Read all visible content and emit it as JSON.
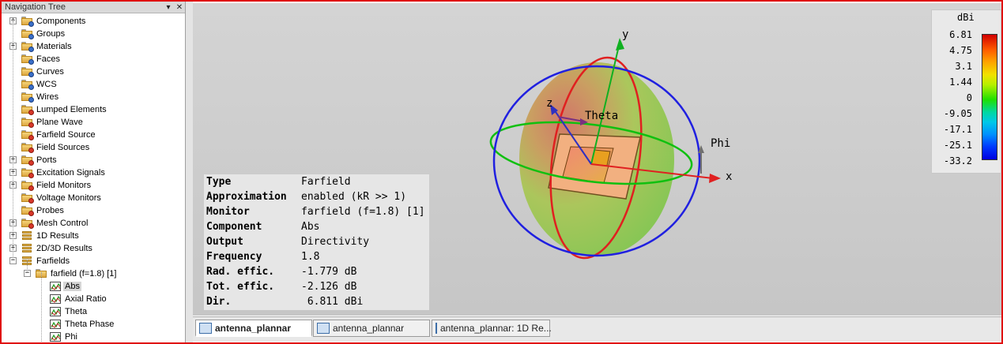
{
  "nav": {
    "title": "Navigation Tree",
    "items": [
      {
        "label": "Components",
        "icon": "folder-components-icon"
      },
      {
        "label": "Groups",
        "icon": "folder-groups-icon"
      },
      {
        "label": "Materials",
        "icon": "folder-materials-icon"
      },
      {
        "label": "Faces",
        "icon": "folder-faces-icon"
      },
      {
        "label": "Curves",
        "icon": "folder-curves-icon"
      },
      {
        "label": "WCS",
        "icon": "folder-wcs-icon"
      },
      {
        "label": "Wires",
        "icon": "folder-wires-icon"
      },
      {
        "label": "Lumped Elements",
        "icon": "folder-lumped-icon"
      },
      {
        "label": "Plane Wave",
        "icon": "folder-planewave-icon"
      },
      {
        "label": "Farfield Source",
        "icon": "folder-farfield-source-icon"
      },
      {
        "label": "Field Sources",
        "icon": "folder-field-sources-icon"
      },
      {
        "label": "Ports",
        "icon": "folder-ports-icon"
      },
      {
        "label": "Excitation Signals",
        "icon": "folder-excitation-icon"
      },
      {
        "label": "Field Monitors",
        "icon": "folder-field-monitors-icon"
      },
      {
        "label": "Voltage Monitors",
        "icon": "folder-voltage-monitors-icon"
      },
      {
        "label": "Probes",
        "icon": "folder-probes-icon"
      },
      {
        "label": "Mesh Control",
        "icon": "folder-mesh-icon"
      },
      {
        "label": "1D Results",
        "icon": "results-1d-icon"
      },
      {
        "label": "2D/3D Results",
        "icon": "results-2d3d-icon"
      },
      {
        "label": "Farfields",
        "icon": "farfields-icon"
      },
      {
        "label": "farfield (f=1.8) [1]",
        "icon": "folder-farfield-icon"
      },
      {
        "label": "Abs",
        "icon": "plot-icon"
      },
      {
        "label": "Axial Ratio",
        "icon": "plot-icon"
      },
      {
        "label": "Theta",
        "icon": "plot-icon"
      },
      {
        "label": "Theta Phase",
        "icon": "plot-icon"
      },
      {
        "label": "Phi",
        "icon": "plot-icon"
      }
    ]
  },
  "view": {
    "axis_x": "x",
    "axis_y": "y",
    "axis_z": "z",
    "theta_label": "Theta",
    "phi_label": "Phi"
  },
  "info": [
    {
      "key": "Type",
      "value": "Farfield"
    },
    {
      "key": "Approximation",
      "value": "enabled (kR >> 1)"
    },
    {
      "key": "Monitor",
      "value": "farfield (f=1.8) [1]"
    },
    {
      "key": "Component",
      "value": "Abs"
    },
    {
      "key": "Output",
      "value": "Directivity"
    },
    {
      "key": "Frequency",
      "value": "1.8"
    },
    {
      "key": "Rad. effic.",
      "value": "-1.779 dB"
    },
    {
      "key": "Tot. effic.",
      "value": "-2.126 dB"
    },
    {
      "key": "Dir.",
      "value": " 6.811 dBi"
    }
  ],
  "legend": {
    "title": "dBi",
    "ticks": [
      "6.81",
      "4.75",
      "3.1",
      "1.44",
      "0",
      "-9.05",
      "-17.1",
      "-25.1",
      "-33.2"
    ]
  },
  "tabs": [
    {
      "label": "antenna_plannar",
      "active": true
    },
    {
      "label": "antenna_plannar",
      "active": false
    },
    {
      "label": "antenna_plannar: 1D Re...",
      "active": false
    }
  ]
}
